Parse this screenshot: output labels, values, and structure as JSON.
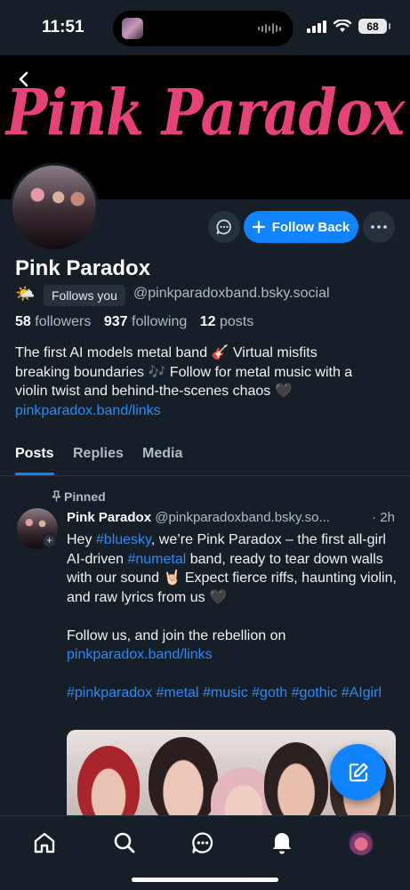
{
  "status_bar": {
    "time": "11:51",
    "battery": "68"
  },
  "banner": {
    "title": "Pink Paradox"
  },
  "profile": {
    "display_name": "Pink Paradox",
    "emoji": "🌤️",
    "follows_you_label": "Follows you",
    "handle": "@pinkparadoxband.bsky.social",
    "stats": {
      "followers_count": "58",
      "followers_label": "followers",
      "following_count": "937",
      "following_label": "following",
      "posts_count": "12",
      "posts_label": "posts"
    },
    "bio_line1": "The first AI models metal band 🎸 Virtual misfits",
    "bio_line2": "breaking boundaries 🎶 Follow for metal music with a",
    "bio_line3": "violin twist and behind-the-scenes chaos 🖤",
    "bio_link": "pinkparadox.band/links"
  },
  "actions": {
    "follow_back_label": "Follow Back"
  },
  "tabs": [
    {
      "label": "Posts"
    },
    {
      "label": "Replies"
    },
    {
      "label": "Media"
    }
  ],
  "post": {
    "pinned_label": "Pinned",
    "author_name": "Pink Paradox",
    "author_handle": "@pinkparadoxband.bsky.so...",
    "time": "· 2h",
    "text": {
      "p1_a": "Hey ",
      "p1_tag1": "#bluesky",
      "p1_b": ", we’re Pink Paradox – the first all-girl AI-driven ",
      "p1_tag2": "#numetal",
      "p1_c": " band, ready to tear down walls with our sound 🤘🏻 Expect fierce riffs, haunting violin, and raw lyrics from us 🖤",
      "p2": "Follow us, and join the rebellion on",
      "p2_link": "pinkparadox.band/links",
      "hashtags": [
        "#pinkparadox",
        "#metal",
        "#music",
        "#goth",
        "#gothic",
        "#AIgirl"
      ]
    }
  },
  "icons": {
    "back": "back-chevron-icon",
    "message": "chat-bubble-icon",
    "more": "more-dots-icon",
    "pin": "pin-icon",
    "compose": "compose-icon",
    "nav": [
      "home-icon",
      "search-icon",
      "chat-icon",
      "notifications-icon",
      "profile-avatar"
    ]
  },
  "colors": {
    "background": "#161e27",
    "accent": "#1083fe",
    "link": "#2b8cf5",
    "banner_text": "#e7417a",
    "muted": "#aebbc9"
  }
}
